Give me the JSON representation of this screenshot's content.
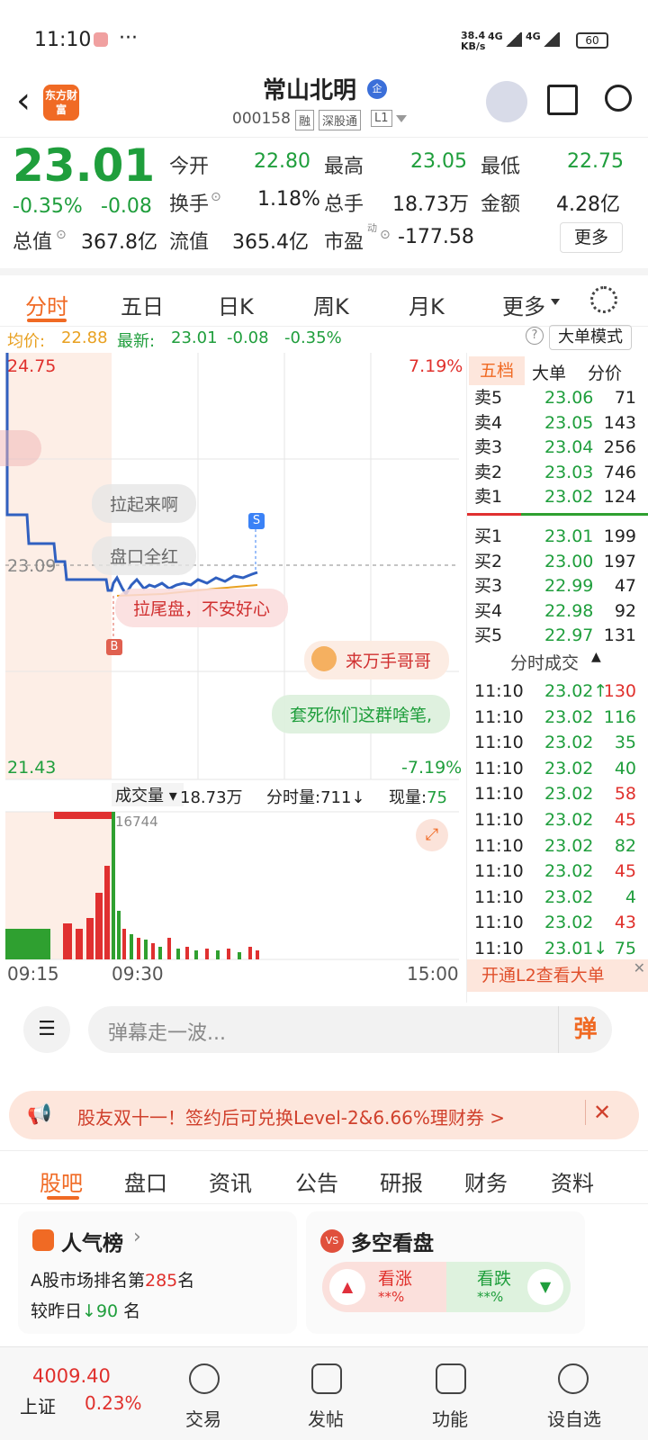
{
  "status_bar": {
    "time": "11:10",
    "dots": "···",
    "net_speed_top": "38.4",
    "net_speed_bottom": "KB/s",
    "sig1": "4G",
    "sig2": "4G",
    "battery": "60"
  },
  "header": {
    "logo": "东方财富",
    "name": "常山北明",
    "badge": "企",
    "code": "000158",
    "tags": [
      "融",
      "深股通",
      "L1"
    ]
  },
  "quote": {
    "price": "23.01",
    "change_pct": "-0.35%",
    "change": "-0.08",
    "open_label": "今开",
    "open": "22.80",
    "high_label": "最高",
    "high": "23.05",
    "low_label": "最低",
    "low": "22.75",
    "turnover_label": "换手",
    "turnover": "1.18%",
    "volume_label": "总手",
    "volume": "18.73万",
    "amount_label": "金额",
    "amount": "4.28亿",
    "mktcap_label": "总值",
    "mktcap": "367.8亿",
    "float_label": "流值",
    "float": "365.4亿",
    "pe_label": "市盈",
    "pe_sup": "动",
    "pe": "-177.58",
    "more": "更多"
  },
  "tabs": [
    "分时",
    "五日",
    "日K",
    "周K",
    "月K",
    "更多"
  ],
  "avg_line": {
    "avg_label": "均价:",
    "avg": "22.88",
    "latest_label": "最新:",
    "latest": "23.01",
    "chg": "-0.08",
    "pct": "-0.35%",
    "mode": "大单模式"
  },
  "chart": {
    "y_high": "24.75",
    "y_high_pct": "7.19%",
    "y_low": "21.43",
    "y_low_pct": "-7.19%",
    "y_mid": "23.09",
    "vol_label": "成交量",
    "vol_total": "18.73万",
    "fen_label": "分时量:711↓",
    "xian_label": "现量:75",
    "vol_peak": "16744",
    "t_start": "09:15",
    "t_mid": "09:30",
    "t_end": "15:00",
    "marker_s": "S",
    "marker_b": "B",
    "bubbles": [
      "拉起来啊",
      "盘口全红",
      "拉尾盘，不安好心",
      "来万手哥哥",
      "套死你们这群啥笔,"
    ]
  },
  "orderbook": {
    "tabs": [
      "五档",
      "大单",
      "分价"
    ],
    "asks": [
      {
        "l": "卖5",
        "p": "23.06",
        "v": "71"
      },
      {
        "l": "卖4",
        "p": "23.05",
        "v": "143"
      },
      {
        "l": "卖3",
        "p": "23.04",
        "v": "256"
      },
      {
        "l": "卖2",
        "p": "23.03",
        "v": "746"
      },
      {
        "l": "卖1",
        "p": "23.02",
        "v": "124"
      }
    ],
    "bids": [
      {
        "l": "买1",
        "p": "23.01",
        "v": "199"
      },
      {
        "l": "买2",
        "p": "23.00",
        "v": "197"
      },
      {
        "l": "买3",
        "p": "22.99",
        "v": "47"
      },
      {
        "l": "买4",
        "p": "22.98",
        "v": "92"
      },
      {
        "l": "买5",
        "p": "22.97",
        "v": "131"
      }
    ],
    "trades_title": "分时成交",
    "trades": [
      {
        "t": "11:10",
        "p": "23.02↑",
        "v": "130"
      },
      {
        "t": "11:10",
        "p": "23.02",
        "v": "116"
      },
      {
        "t": "11:10",
        "p": "23.02",
        "v": "35"
      },
      {
        "t": "11:10",
        "p": "23.02",
        "v": "40"
      },
      {
        "t": "11:10",
        "p": "23.02",
        "v": "58"
      },
      {
        "t": "11:10",
        "p": "23.02",
        "v": "45"
      },
      {
        "t": "11:10",
        "p": "23.02",
        "v": "82"
      },
      {
        "t": "11:10",
        "p": "23.02",
        "v": "45"
      },
      {
        "t": "11:10",
        "p": "23.02",
        "v": "4"
      },
      {
        "t": "11:10",
        "p": "23.02",
        "v": "43"
      },
      {
        "t": "11:10",
        "p": "23.01↓",
        "v": "75"
      }
    ],
    "l2": "开通L2查看大单"
  },
  "comment": {
    "placeholder": "弹幕走一波...",
    "btn": "弹"
  },
  "promo": {
    "text": "股友双十一！签约后可兑换Level-2&6.66%理财券 >"
  },
  "subtabs": [
    "股吧",
    "盘口",
    "资讯",
    "公告",
    "研报",
    "财务",
    "资料"
  ],
  "cards": {
    "pop_title": "人气榜",
    "pop_rank_pre": "A股市场排名第",
    "pop_rank": "285",
    "pop_rank_post": "名",
    "pop_cmp_pre": "较昨日",
    "pop_cmp": "90",
    "pop_cmp_post": "名",
    "ls_title": "多空看盘",
    "up": "看涨",
    "up_pct": "**%",
    "down": "看跌",
    "down_pct": "**%"
  },
  "bottom_nav": {
    "index_val": "4009.40",
    "index_name": "上证",
    "index_pct": "0.23%",
    "items": [
      "交易",
      "发帖",
      "功能",
      "设自选"
    ]
  }
}
